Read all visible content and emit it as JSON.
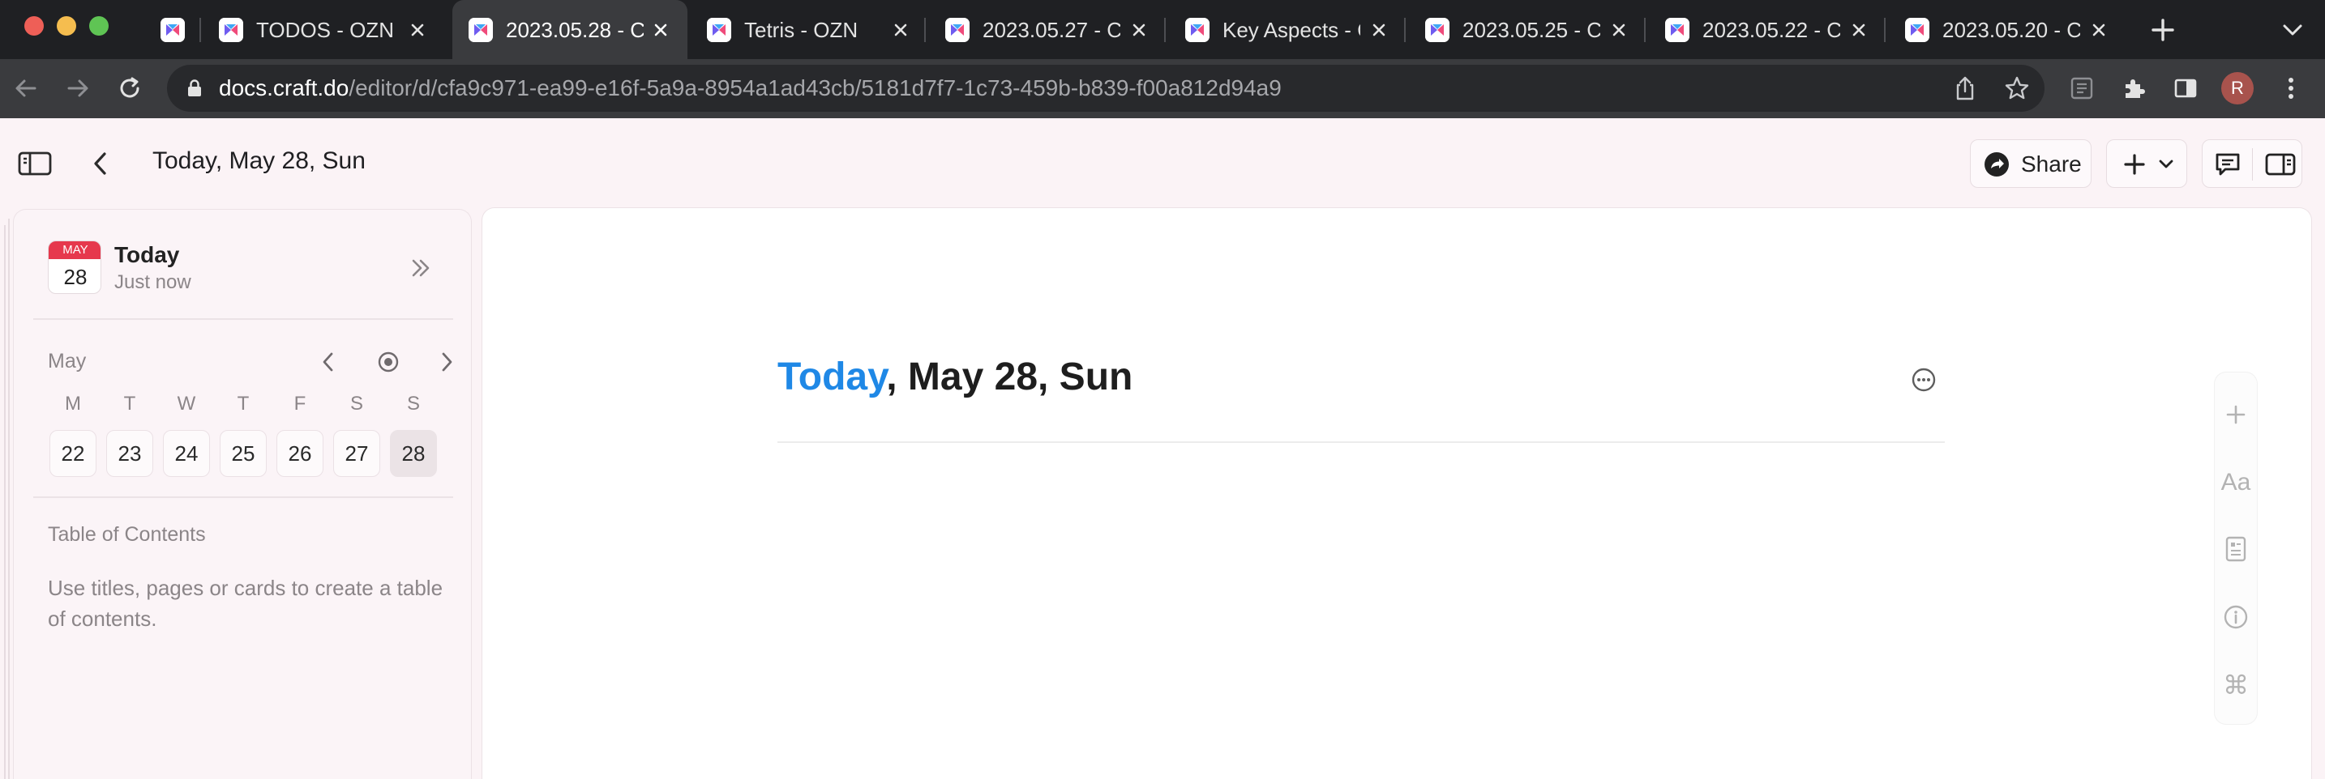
{
  "browser": {
    "tabs": [
      {
        "title": "",
        "active": false
      },
      {
        "title": "TODOS - OZN",
        "active": false
      },
      {
        "title": "2023.05.28 - C",
        "active": true
      },
      {
        "title": "Tetris - OZN",
        "active": false
      },
      {
        "title": "2023.05.27 - C",
        "active": false
      },
      {
        "title": "Key Aspects - C",
        "active": false
      },
      {
        "title": "2023.05.25 - C",
        "active": false
      },
      {
        "title": "2023.05.22 - C",
        "active": false
      },
      {
        "title": "2023.05.20 - C",
        "active": false
      }
    ],
    "url": {
      "host": "docs.craft.do",
      "path": "/editor/d/cfa9c971-ea99-e16f-5a9a-8954a1ad43cb/5181d7f7-1c73-459b-b839-f00a812d94a9"
    },
    "profile_initial": "R"
  },
  "header": {
    "title": "Today, May 28, Sun",
    "share_label": "Share"
  },
  "sidebar": {
    "calendar_icon": {
      "month": "MAY",
      "day": "28"
    },
    "today_title": "Today",
    "today_subtitle": "Just now",
    "month_label": "May",
    "weekdays": [
      "M",
      "T",
      "W",
      "T",
      "F",
      "S",
      "S"
    ],
    "days": [
      "22",
      "23",
      "24",
      "25",
      "26",
      "27",
      "28"
    ],
    "selected_day": "28",
    "toc_title": "Table of Contents",
    "toc_hint": "Use titles, pages or cards to create a table of contents."
  },
  "document": {
    "heading_accent": "Today",
    "heading_rest": ", May 28, Sun",
    "accent_color": "#1f88e6"
  },
  "side_tools": {
    "format_label": "Aa",
    "shortcut_label": "⌘"
  },
  "colors": {
    "chrome_dark": "#1f2023",
    "chrome_toolbar": "#3a3b3e",
    "app_background": "#fbf3f6",
    "calendar_red": "#e6384d"
  }
}
